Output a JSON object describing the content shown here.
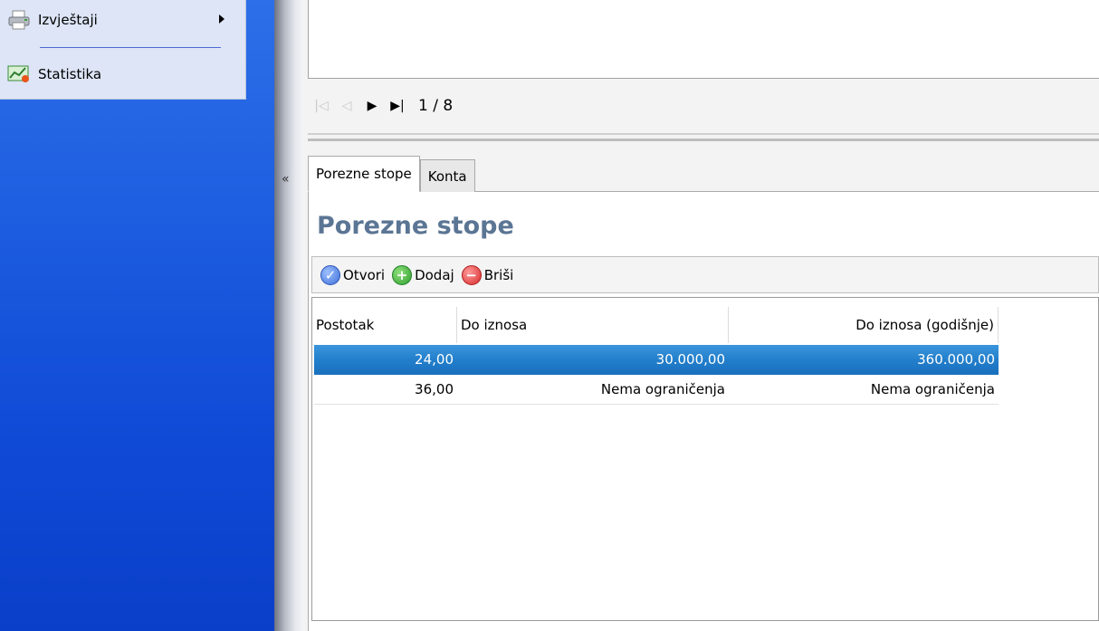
{
  "sidebar": {
    "menu": [
      {
        "label": "Izvještaji",
        "icon": "printer-icon",
        "has_submenu": true
      },
      {
        "label": "Statistika",
        "icon": "chart-icon",
        "has_submenu": false
      }
    ]
  },
  "navigator": {
    "page_indicator": "1 / 8"
  },
  "tabs": [
    {
      "label": "Porezne stope",
      "active": true
    },
    {
      "label": "Konta",
      "active": false
    }
  ],
  "section": {
    "title": "Porezne stope"
  },
  "toolbar": {
    "open_label": "Otvori",
    "add_label": "Dodaj",
    "delete_label": "Briši"
  },
  "grid": {
    "columns": [
      "Postotak",
      "Do iznosa",
      "Do iznosa (godišnje)"
    ],
    "rows": [
      {
        "postotak": "24,00",
        "do_iznosa": "30.000,00",
        "do_iznosa_godisnje": "360.000,00",
        "selected": true
      },
      {
        "postotak": "36,00",
        "do_iznosa": "Nema ograničenja",
        "do_iznosa_godisnje": "Nema ograničenja",
        "selected": false
      }
    ]
  },
  "colors": {
    "sidebar_blue": "#1d5de0",
    "selection_blue": "#2380cc",
    "title_color": "#5b7594"
  }
}
